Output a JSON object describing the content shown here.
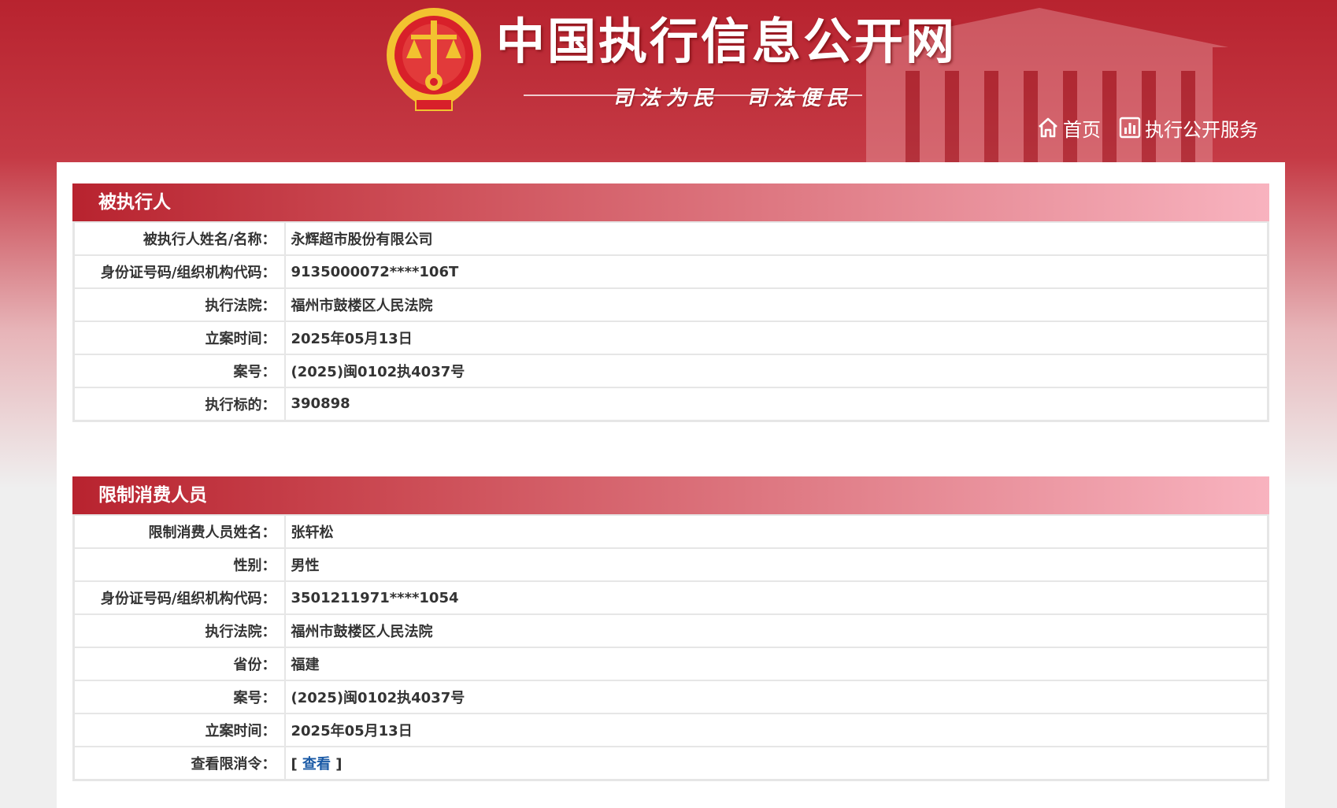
{
  "header": {
    "site_title": "中国执行信息公开网",
    "slogan": "司法为民　司法便民",
    "nav": [
      {
        "label": "首页",
        "icon": "home-icon"
      },
      {
        "label": "执行公开服务",
        "icon": "chart-icon"
      }
    ]
  },
  "colors": {
    "brand_red": "#b8232f",
    "emblem_gold": "#f2c230",
    "emblem_red": "#d8202a",
    "link_blue": "#1a5aa6"
  },
  "section_executed": {
    "title": "被执行人",
    "rows": [
      {
        "label": "被执行人姓名/名称：",
        "value": "永辉超市股份有限公司"
      },
      {
        "label": "身份证号码/组织机构代码：",
        "value": "9135000072****106T"
      },
      {
        "label": "执行法院：",
        "value": "福州市鼓楼区人民法院"
      },
      {
        "label": "立案时间：",
        "value": "2025年05月13日"
      },
      {
        "label": "案号：",
        "value": "(2025)闽0102执4037号"
      },
      {
        "label": "执行标的：",
        "value": "390898"
      }
    ]
  },
  "section_restricted": {
    "title": "限制消费人员",
    "rows": [
      {
        "label": "限制消费人员姓名：",
        "value": "张轩松"
      },
      {
        "label": "性别：",
        "value": "男性"
      },
      {
        "label": "身份证号码/组织机构代码：",
        "value": "3501211971****1054"
      },
      {
        "label": "执行法院：",
        "value": "福州市鼓楼区人民法院"
      },
      {
        "label": "省份：",
        "value": "福建"
      },
      {
        "label": "案号：",
        "value": "(2025)闽0102执4037号"
      },
      {
        "label": "立案时间：",
        "value": "2025年05月13日"
      }
    ],
    "order_row": {
      "label": "查看限消令：",
      "bracket_open": "[",
      "link": "查看",
      "bracket_close": "]"
    }
  }
}
